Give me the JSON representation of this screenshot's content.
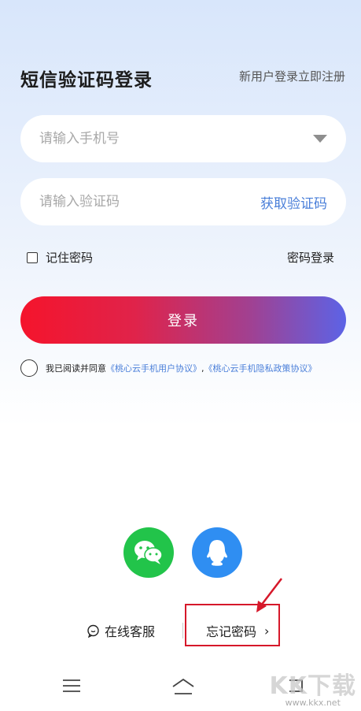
{
  "header": {
    "title": "短信验证码登录",
    "register_link": "新用户登录立即注册"
  },
  "form": {
    "phone_placeholder": "请输入手机号",
    "code_placeholder": "请输入验证码",
    "get_code_label": "获取验证码",
    "remember_label": "记住密码",
    "password_login_label": "密码登录",
    "login_button": "登录"
  },
  "agreement": {
    "prefix": "我已阅读并同意",
    "user_agreement": "《桃心云手机用户协议》",
    "separator": ",",
    "privacy_policy": "《桃心云手机隐私政策协议》"
  },
  "social": {
    "wechat_icon": "wechat-icon",
    "qq_icon": "qq-icon"
  },
  "footer": {
    "service_label": "在线客服",
    "forgot_label": "忘记密码",
    "forgot_chevron": "›"
  },
  "watermark": {
    "main": "KK下载",
    "url": "www.kkx.net"
  },
  "colors": {
    "accent_blue": "#4a7fd9",
    "login_gradient_start": "#f5142c",
    "login_gradient_end": "#5c63e6",
    "wechat_green": "#22c44a",
    "qq_blue": "#2f8ef2",
    "highlight_red": "#d6182a"
  }
}
